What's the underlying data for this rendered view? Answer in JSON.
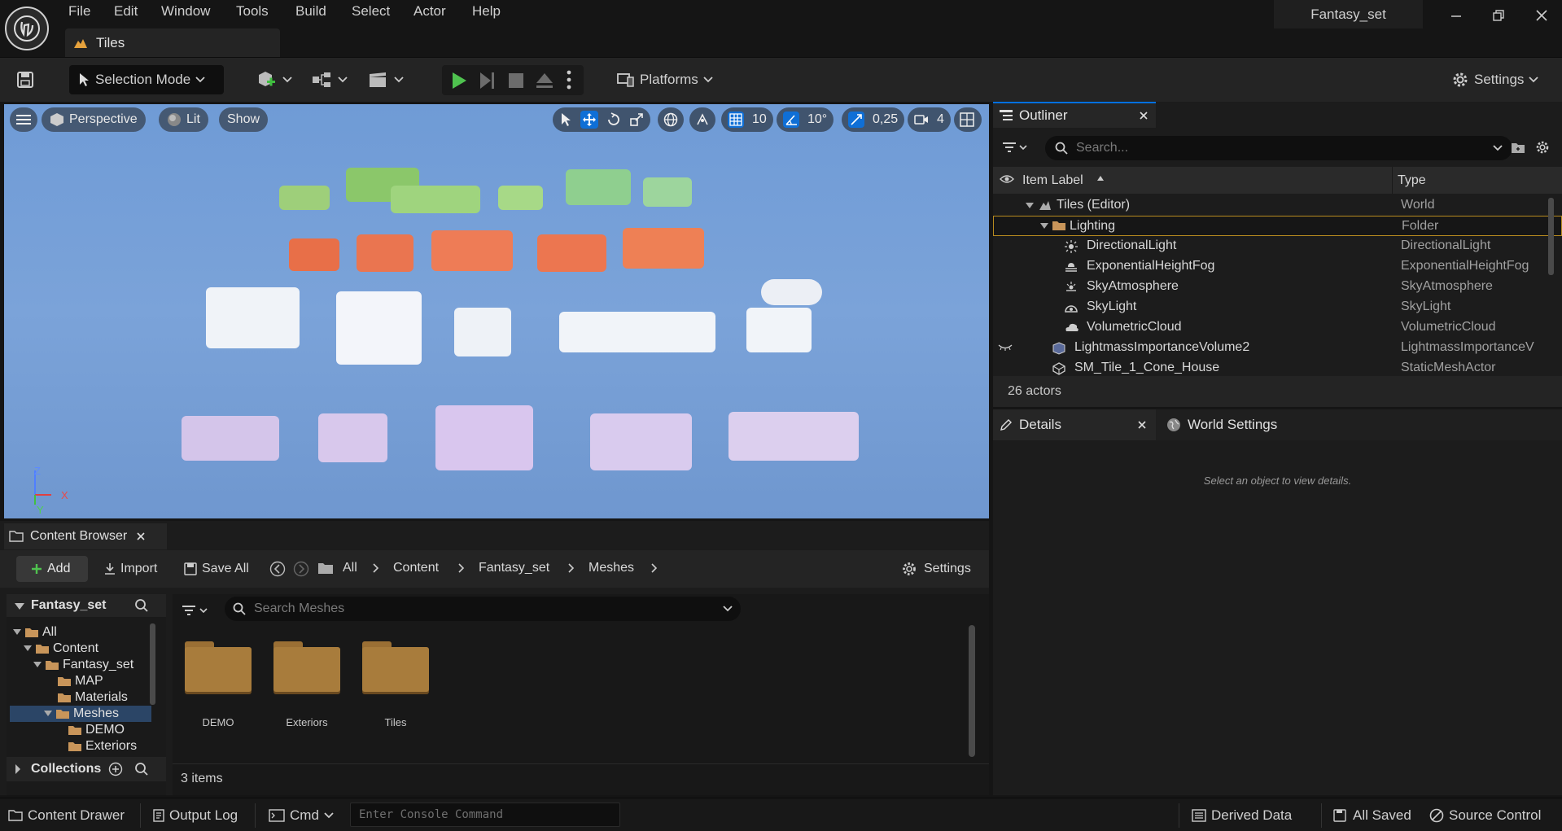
{
  "app": {
    "project_name": "Fantasy_set",
    "level_tab": "Tiles"
  },
  "menu": [
    "File",
    "Edit",
    "Window",
    "Tools",
    "Build",
    "Select",
    "Actor",
    "Help"
  ],
  "toolbar": {
    "selection_mode": "Selection Mode",
    "platforms": "Platforms",
    "settings": "Settings"
  },
  "viewport": {
    "perspective": "Perspective",
    "lit": "Lit",
    "show": "Show",
    "grid_snap": "10",
    "rotation_snap": "10°",
    "scale_snap": "0,25",
    "camera_speed": "4",
    "axis_z": "Z",
    "axis_x": "X",
    "axis_y": "Y"
  },
  "outliner": {
    "tab": "Outliner",
    "search_placeholder": "Search...",
    "col_label": "Item Label",
    "col_type": "Type",
    "rows": [
      {
        "label": "Tiles (Editor)",
        "type": "World"
      },
      {
        "label": "Lighting",
        "type": "Folder"
      },
      {
        "label": "DirectionalLight",
        "type": "DirectionalLight"
      },
      {
        "label": "ExponentialHeightFog",
        "type": "ExponentialHeightFog"
      },
      {
        "label": "SkyAtmosphere",
        "type": "SkyAtmosphere"
      },
      {
        "label": "SkyLight",
        "type": "SkyLight"
      },
      {
        "label": "VolumetricCloud",
        "type": "VolumetricCloud"
      },
      {
        "label": "LightmassImportanceVolume2",
        "type": "LightmassImportanceV"
      },
      {
        "label": "SM_Tile_1_Cone_House",
        "type": "StaticMeshActor"
      }
    ],
    "footer": "26 actors"
  },
  "details": {
    "tab": "Details",
    "world_settings_tab": "World Settings",
    "empty_message": "Select an object to view details."
  },
  "content_browser": {
    "tab": "Content Browser",
    "add": "Add",
    "import": "Import",
    "save_all": "Save All",
    "breadcrumb": [
      "All",
      "Content",
      "Fantasy_set",
      "Meshes"
    ],
    "settings": "Settings",
    "tree_header": "Fantasy_set",
    "tree": [
      "All",
      "Content",
      "Fantasy_set",
      "MAP",
      "Materials",
      "Meshes",
      "DEMO",
      "Exteriors"
    ],
    "collections": "Collections",
    "search_placeholder": "Search Meshes",
    "folders": [
      "DEMO",
      "Exteriors",
      "Tiles"
    ],
    "item_count": "3 items"
  },
  "statusbar": {
    "content_drawer": "Content Drawer",
    "output_log": "Output Log",
    "cmd": "Cmd",
    "console_placeholder": "Enter Console Command",
    "derived_data": "Derived Data",
    "all_saved": "All Saved",
    "source_control": "Source Control"
  }
}
